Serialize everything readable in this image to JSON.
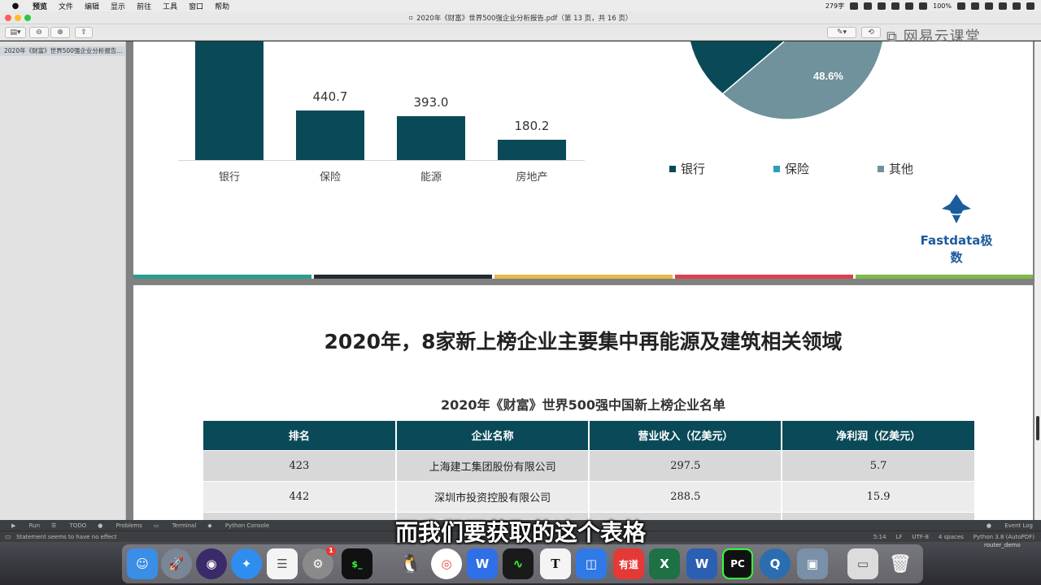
{
  "menubar": {
    "items": [
      "预览",
      "文件",
      "编辑",
      "显示",
      "前往",
      "工具",
      "窗口",
      "帮助"
    ],
    "word_count": "279字",
    "battery": "100%"
  },
  "window": {
    "title": "2020年《财富》世界500强企业分析报告.pdf（第 13 页，共 16 页）"
  },
  "watermark": "网易云课堂",
  "sidebar": {
    "thumbnail_label": "2020年《财富》世界500强企业分析报告..."
  },
  "chart_data": [
    {
      "type": "bar",
      "categories": [
        "银行",
        "保险",
        "能源",
        "房地产"
      ],
      "values": [
        null,
        440.7,
        393.0,
        180.2
      ],
      "value_labels": [
        "",
        "440.7",
        "393.0",
        "180.2"
      ]
    },
    {
      "type": "pie",
      "slices": [
        {
          "name": "银行",
          "value": null,
          "color": "#0a4a58"
        },
        {
          "name": "保险",
          "value": null,
          "color": "#2aa0b8"
        },
        {
          "name": "其他",
          "value": 48.6,
          "label": "48.6%",
          "color": "#6f929c"
        }
      ]
    }
  ],
  "logo": {
    "text": "Fastdata极数"
  },
  "strip_colors": [
    "#2a9d8f",
    "#222a33",
    "#e9b949",
    "#d9434b",
    "#7dbb4a"
  ],
  "page2": {
    "heading": "2020年，8家新上榜企业主要集中再能源及建筑相关领域",
    "table_title": "2020年《财富》世界500强中国新上榜企业名单",
    "columns": [
      "排名",
      "企业名称",
      "营业收入（亿美元）",
      "净利润（亿美元）"
    ],
    "rows": [
      [
        "423",
        "上海建工集团股份有限公司",
        "297.5",
        "5.7"
      ],
      [
        "442",
        "深圳市投资控股有限公司",
        "288.5",
        "15.9"
      ]
    ]
  },
  "ide": {
    "tabs": [
      "Run",
      "TODO",
      "Problems",
      "Terminal",
      "Python Console"
    ],
    "event_log": "Event Log",
    "status_message": "Statement seems to have no effect",
    "status_right": [
      "5:14",
      "LF",
      "UTF-8",
      "4 spaces",
      "Python 3.8 (AutoPDF)"
    ]
  },
  "subtitle": "而我们要获取的这个表格",
  "dock": {
    "settings_badge": "1",
    "desktop_label": "router_demo"
  }
}
